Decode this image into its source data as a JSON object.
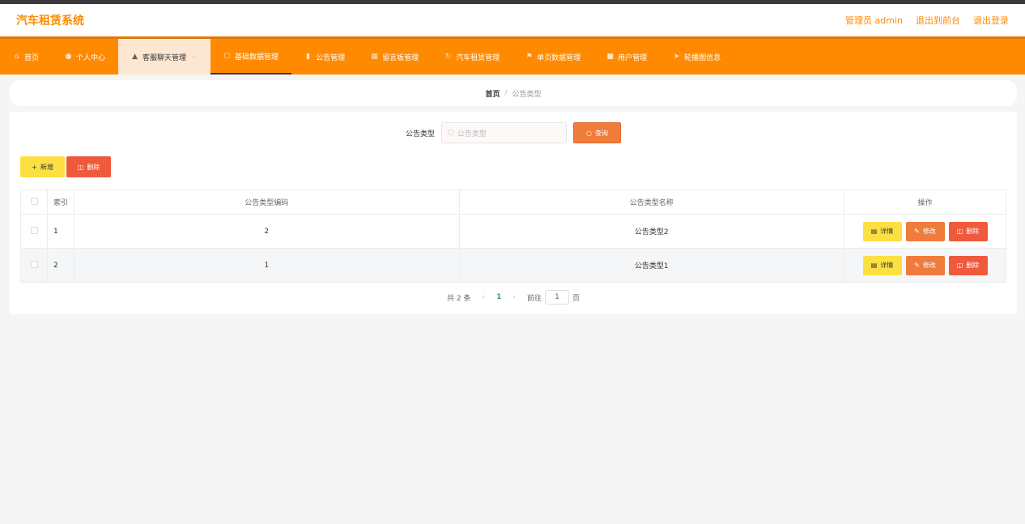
{
  "header": {
    "title": "汽车租赁系统",
    "admin_label": "管理员 admin",
    "to_front": "退出到前台",
    "logout": "退出登录"
  },
  "nav": {
    "items": [
      {
        "label": "首页",
        "icon": "home-icon"
      },
      {
        "label": "个人中心",
        "icon": "user-icon"
      },
      {
        "label": "客服聊天管理",
        "icon": "chat-icon"
      },
      {
        "label": "基础数据管理",
        "icon": "data-icon"
      },
      {
        "label": "公告管理",
        "icon": "notice-icon"
      },
      {
        "label": "留言板管理",
        "icon": "message-icon"
      },
      {
        "label": "汽车租赁管理",
        "icon": "car-icon"
      },
      {
        "label": "单页数据管理",
        "icon": "flag-icon"
      },
      {
        "label": "用户管理",
        "icon": "users-icon"
      },
      {
        "label": "轮播图信息",
        "icon": "send-icon"
      }
    ]
  },
  "breadcrumb": {
    "home": "首页",
    "separator": "/",
    "current": "公告类型"
  },
  "search": {
    "label": "公告类型",
    "placeholder": "公告类型",
    "query_button": "查询"
  },
  "actions": {
    "add": "新增",
    "delete": "删除"
  },
  "table": {
    "headers": [
      "索引",
      "公告类型编码",
      "公告类型名称",
      "操作"
    ],
    "rows": [
      {
        "index": "1",
        "code": "2",
        "name": "公告类型2"
      },
      {
        "index": "2",
        "code": "1",
        "name": "公告类型1"
      }
    ],
    "ops": {
      "detail": "详情",
      "edit": "修改",
      "delete": "删除"
    }
  },
  "pager": {
    "total": "共 2 条",
    "current": "1",
    "goto": "前往",
    "page_value": "1",
    "page_unit": "页"
  },
  "colors": {
    "accent": "#ff8a00",
    "query": "#f07c3c",
    "add": "#fce042",
    "danger": "#ef5a3c"
  }
}
